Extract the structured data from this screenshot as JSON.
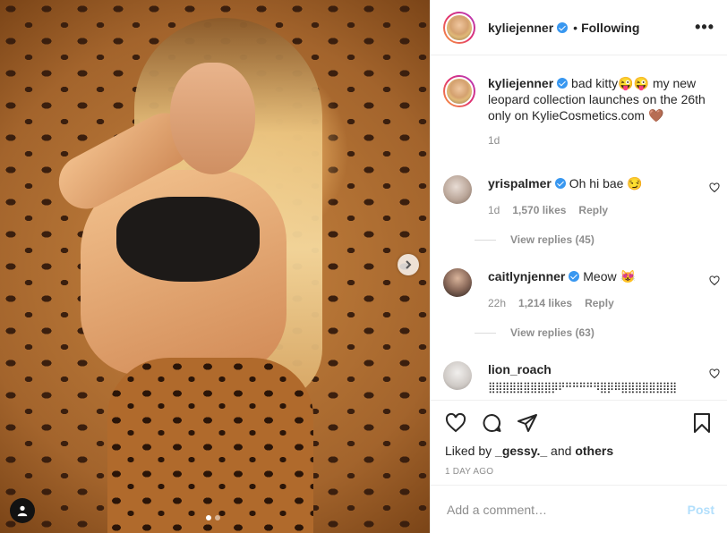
{
  "post": {
    "author": "kyliejenner",
    "following_label": "Following",
    "separator": "•",
    "more_label": "•••"
  },
  "caption": {
    "username": "kyliejenner",
    "text": "bad kitty😜😜 my new leopard collection launches on the 26th only on KylieCosmetics.com 🤎",
    "time": "1d"
  },
  "comments": [
    {
      "username": "yrispalmer",
      "verified": true,
      "text": "Oh hi bae 😏",
      "time": "1d",
      "likes": "1,570 likes",
      "reply": "Reply",
      "view_replies": "View replies (45)"
    },
    {
      "username": "caitlynjenner",
      "verified": true,
      "text": "Meow 😻",
      "time": "22h",
      "likes": "1,214 likes",
      "reply": "Reply",
      "view_replies": "View replies (63)"
    },
    {
      "username": "lion_roach",
      "verified": false,
      "text": "⣿⣿⣿⣿⣿⣿⣿⣿⣿⡿⠟⠛⠛⠛⠛⠻⣿⡿⠿⣿⣿⣿⣿⣿⣿⣿⣿"
    }
  ],
  "footer": {
    "liked_prefix": "Liked by ",
    "liked_user": "_gessy._",
    "liked_and": " and ",
    "liked_others": "others",
    "timestamp": "1 DAY AGO",
    "comment_placeholder": "Add a comment…",
    "post_label": "Post"
  },
  "colors": {
    "verified": "#3897f0",
    "post_disabled": "#b2dffc",
    "meta_gray": "#8e8e8e"
  }
}
